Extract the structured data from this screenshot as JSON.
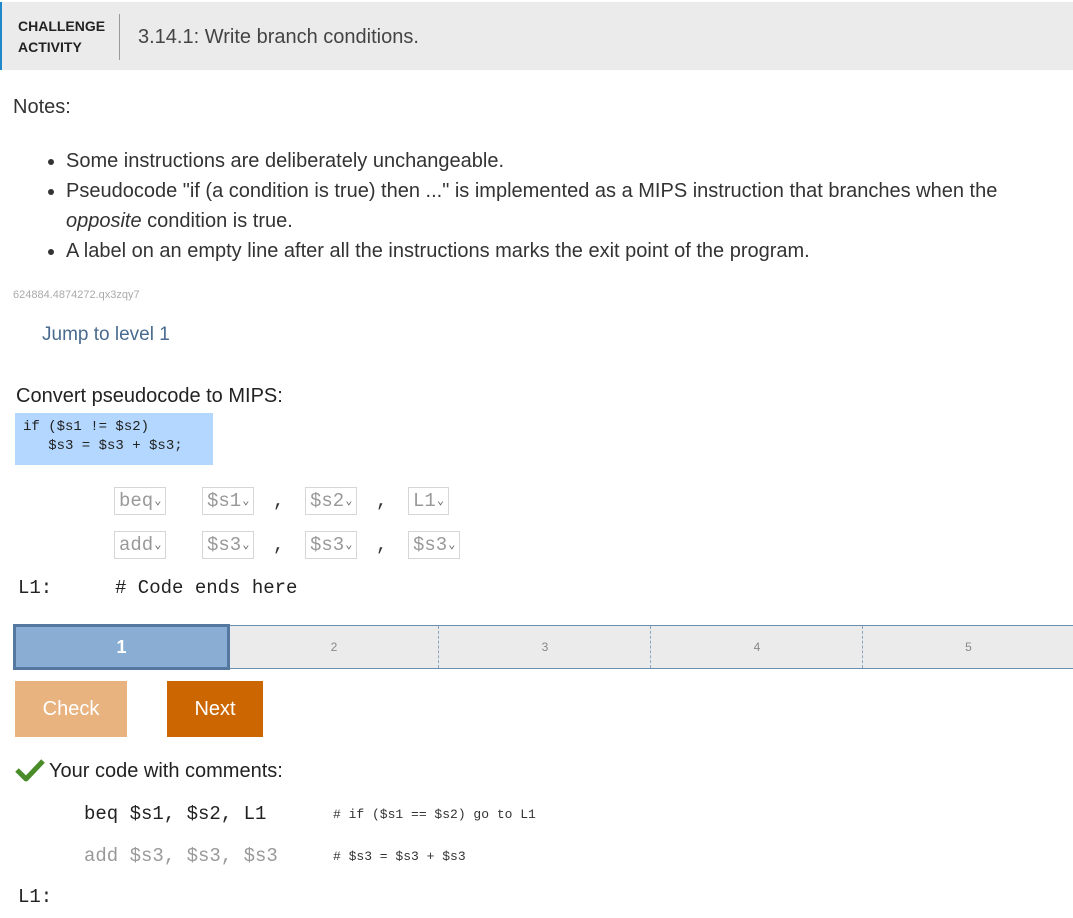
{
  "header": {
    "tag_line1": "CHALLENGE",
    "tag_line2": "ACTIVITY",
    "title": "3.14.1: Write branch conditions."
  },
  "notes": {
    "title": "Notes:",
    "items": [
      "Some instructions are deliberately unchangeable.",
      "A label on an empty line after all the instructions marks the exit point of the program."
    ],
    "item2": {
      "before": "Pseudocode \"if (a condition is true) then ...\" is implemented as a MIPS instruction that branches when the ",
      "emph": "opposite",
      "after": " condition is true."
    }
  },
  "activity_id": "624884.4874272.qx3zqy7",
  "jump_link": "Jump to level 1",
  "convert": {
    "title": "Convert pseudocode to MIPS:",
    "pseudocode": "if ($s1 != $s2)\n   $s3 = $s3 + $s3;"
  },
  "code": {
    "row1": [
      "beq",
      "$s1",
      "$s2",
      "L1"
    ],
    "row2": [
      "add",
      "$s3",
      "$s3",
      "$s3"
    ],
    "comma": ",",
    "label": "L1:",
    "comment": "# Code ends here"
  },
  "progress": {
    "levels": [
      "1",
      "2",
      "3",
      "4",
      "5"
    ],
    "current": "1"
  },
  "buttons": {
    "check": "Check",
    "next": "Next"
  },
  "result": {
    "title": "Your code with comments:",
    "line1_code": "beq $s1, $s2, L1",
    "line1_comment": "# if ($s1 == $s2) go to L1",
    "line2_code": "add $s3, $s3, $s3",
    "line2_comment": "# $s3 = $s3 + $s3",
    "label": "L1:"
  },
  "colors": {
    "accent": "#1e88c8",
    "check_button": "#e8b37f",
    "next_button": "#cc6600",
    "pseudo_bg": "#b3d7ff",
    "success": "#4a8c2a"
  }
}
